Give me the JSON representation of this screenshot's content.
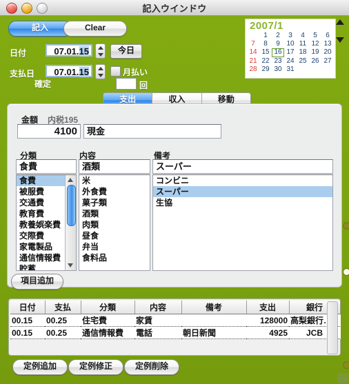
{
  "window": {
    "title": "記入ウインドウ",
    "controls": {
      "close": "close",
      "minimize": "minimize",
      "zoom": "zoom"
    }
  },
  "toolbar": {
    "record_label": "記入",
    "clear_label": "Clear"
  },
  "calendar": {
    "title": "2007/1",
    "selected_day": "16",
    "sundays": [
      "7",
      "14",
      "21",
      "28"
    ],
    "weeks": [
      [
        "",
        "1",
        "2",
        "3",
        "4",
        "5",
        "6"
      ],
      [
        "7",
        "8",
        "9",
        "10",
        "11",
        "12",
        "13"
      ],
      [
        "14",
        "15",
        "16",
        "17",
        "18",
        "19",
        "20"
      ],
      [
        "21",
        "22",
        "23",
        "24",
        "25",
        "26",
        "27"
      ],
      [
        "28",
        "29",
        "30",
        "31",
        "",
        "",
        ""
      ]
    ]
  },
  "form": {
    "date_label": "日付",
    "date_value": "07.01.",
    "date_selected": "15",
    "payday_label": "支払日",
    "payday_value": "07.01.",
    "payday_selected": "15",
    "confirm_label": "確定",
    "today_button": "今日",
    "monthly_label": "月払い",
    "monthly_checked": false,
    "times_value": "",
    "times_unit": "回"
  },
  "tabs": [
    {
      "label": "支出",
      "selected": true
    },
    {
      "label": "収入",
      "selected": false
    },
    {
      "label": "移動",
      "selected": false
    }
  ],
  "panel": {
    "amount_label": "金額",
    "tax_label": "内税195",
    "amount_value": "4100",
    "method_value": "現金",
    "category_label": "分類",
    "content_label": "内容",
    "note_label": "備考",
    "category_value": "食費",
    "content_value": "酒類",
    "note_value": "スーパー",
    "category_list": [
      "食費",
      "被服費",
      "交通費",
      "教育費",
      "教養娯楽費",
      "交際費",
      "家電製品",
      "通信情報費",
      "貯蓄"
    ],
    "category_selected": "食費",
    "content_list": [
      "米",
      "外食費",
      "菓子類",
      "酒類",
      "肉類",
      "昼食",
      "弁当",
      "食料品"
    ],
    "content_selected": "",
    "note_list": [
      "コンビニ",
      "スーパー",
      "生協"
    ],
    "note_selected": "スーパー",
    "add_item_button": "項目追加"
  },
  "table": {
    "headers": [
      "日付",
      "支払",
      "分類",
      "内容",
      "備考",
      "支出",
      "銀行"
    ],
    "rows": [
      {
        "date": "00.15",
        "payday": "00.25",
        "category": "住宅費",
        "content": "家賃",
        "note": "",
        "expense": "128000",
        "bank": "高梨銀行普通預…"
      },
      {
        "date": "00.15",
        "payday": "00.25",
        "category": "通信情報費",
        "content": "電話",
        "note": "朝日新聞",
        "expense": "4925",
        "bank": "JCB"
      }
    ]
  },
  "footer": {
    "add_label": "定例追加",
    "edit_label": "定例修正",
    "delete_label": "定例削除"
  },
  "colors": {
    "background": "#7ba30f",
    "accent_blue": "#2f86e8",
    "calendar_title": "#8ab42a",
    "sunday": "#e03a2e",
    "selection": "#aacdee"
  }
}
